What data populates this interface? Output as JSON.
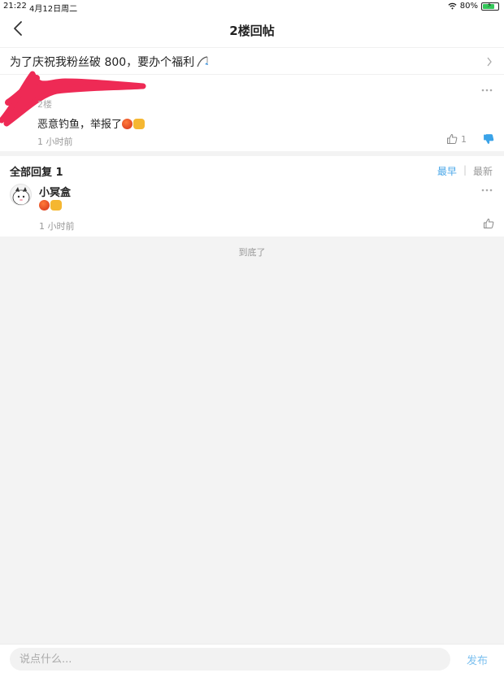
{
  "status_bar": {
    "time": "21:22",
    "date": "4月12日周二",
    "battery": "80%",
    "battery_level": 0.8
  },
  "nav": {
    "title": "2楼回帖"
  },
  "thread": {
    "title": "为了庆祝我粉丝破 800，要办个福利"
  },
  "post": {
    "floor": "2楼",
    "content": "恶意钓鱼，举报了",
    "time": "1 小时前",
    "like_count": "1"
  },
  "replies": {
    "heading": "全部回复 1",
    "sort_newest": "最早",
    "sort_latest": "最新",
    "items": [
      {
        "username": "小冥盒",
        "time": "1 小时前"
      }
    ]
  },
  "end_text": "到底了",
  "bottom": {
    "placeholder": "说点什么...",
    "publish": "发布"
  },
  "colors": {
    "accent": "#4aa7e8",
    "background": "#f3f3f3",
    "scribble": "#ee2a55"
  }
}
